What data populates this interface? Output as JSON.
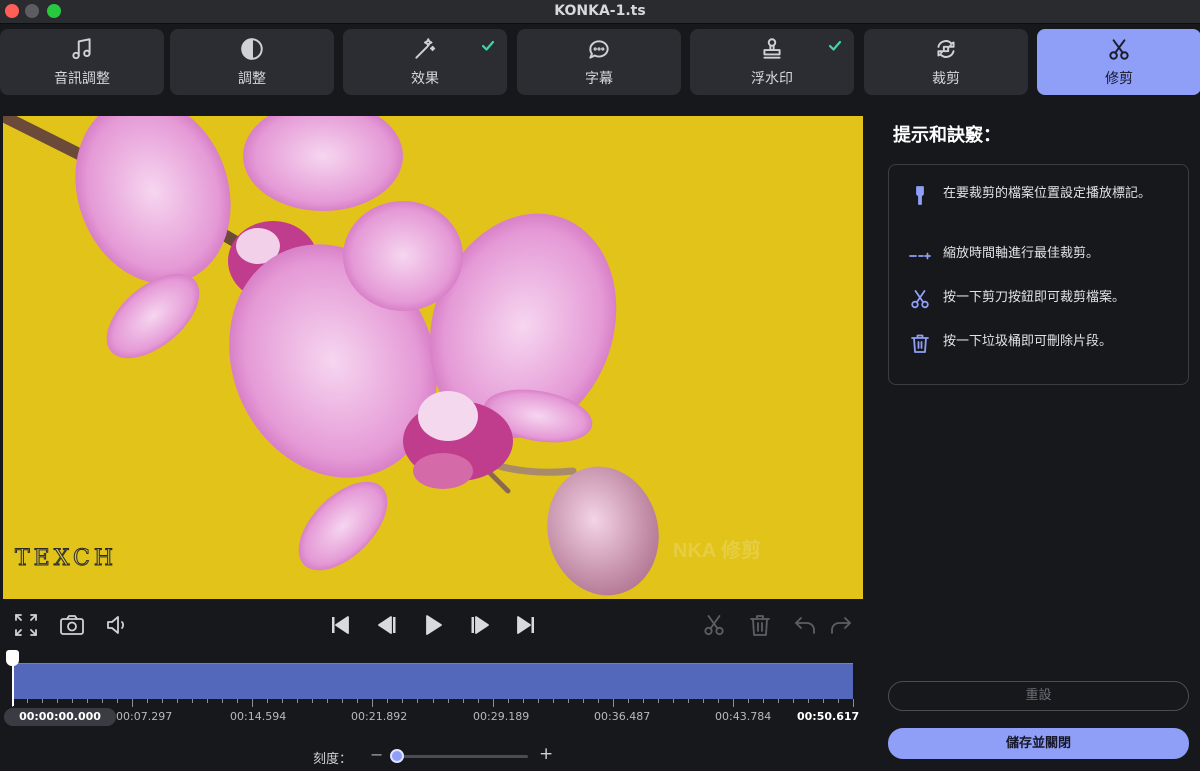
{
  "window": {
    "title": "KONKA-1.ts"
  },
  "tabs": [
    {
      "label": "音訊調整",
      "icon": "music-note-icon",
      "checked": false
    },
    {
      "label": "調整",
      "icon": "contrast-icon",
      "checked": false
    },
    {
      "label": "效果",
      "icon": "magic-wand-icon",
      "checked": true
    },
    {
      "label": "字幕",
      "icon": "speech-bubble-icon",
      "checked": false
    },
    {
      "label": "浮水印",
      "icon": "stamp-icon",
      "checked": true
    },
    {
      "label": "裁剪",
      "icon": "crop-rotate-icon",
      "checked": false
    },
    {
      "label": "修剪",
      "icon": "scissors-icon",
      "checked": false,
      "active": true
    }
  ],
  "video": {
    "watermark_text": "TEXCH",
    "overlay_text": "NKA 修剪"
  },
  "playback": {
    "current_time": "00:00:00.000",
    "timestamps": [
      "00:07.297",
      "00:14.594",
      "00:21.892",
      "00:29.189",
      "00:36.487",
      "00:43.784",
      "00:50.617"
    ]
  },
  "scale": {
    "label": "刻度：",
    "minus": "−",
    "plus": "+",
    "value": 0.05
  },
  "tips": {
    "title": "提示和訣竅：",
    "items": [
      {
        "icon": "pin-marker-icon",
        "text": "在要裁剪的檔案位置設定播放標記。"
      },
      {
        "icon": "zoom-timeline-icon",
        "text": "縮放時間軸進行最佳裁剪。"
      },
      {
        "icon": "scissors-icon",
        "text": "按一下剪刀按鈕即可裁剪檔案。"
      },
      {
        "icon": "trash-icon",
        "text": "按一下垃圾桶即可刪除片段。"
      }
    ]
  },
  "buttons": {
    "reset": "重設",
    "save_close": "儲存並關閉"
  },
  "colors": {
    "accent": "#8f9ef6",
    "check": "#3fd6a2",
    "track": "#5468bb",
    "video_bg": "#e2c31a"
  }
}
